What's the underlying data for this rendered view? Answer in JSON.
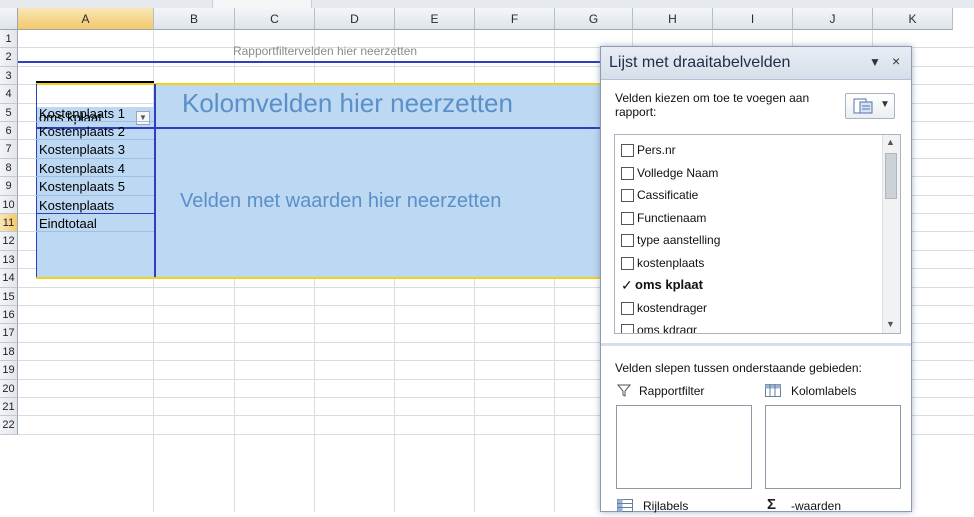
{
  "columns": [
    "A",
    "B",
    "C",
    "D",
    "E",
    "F",
    "G",
    "H",
    "I",
    "J",
    "K"
  ],
  "rows": [
    "1",
    "2",
    "3",
    "4",
    "5",
    "6",
    "7",
    "8",
    "9",
    "10",
    "11",
    "12",
    "13",
    "14",
    "15",
    "16",
    "17",
    "18",
    "19",
    "20",
    "21",
    "22"
  ],
  "pivot": {
    "report_filter_drop": "Rapportfiltervelden hier neerzetten",
    "column_drop": "Kolomvelden hier neerzetten",
    "values_drop": "Velden met waarden hier neerzetten",
    "row_header": "oms kplaat",
    "row_items": [
      "Kostenplaats 1",
      "Kostenplaats 2",
      "Kostenplaats 3",
      "Kostenplaats 4",
      "Kostenplaats 5",
      "Kostenplaats",
      "Eindtotaal"
    ]
  },
  "pane": {
    "title": "Lijst met draaitabelvelden",
    "choose_label": "Velden kiezen om toe te voegen aan rapport:",
    "fields": [
      {
        "name": "Pers.nr",
        "checked": false
      },
      {
        "name": "Volledge Naam",
        "checked": false
      },
      {
        "name": "Cassificatie",
        "checked": false
      },
      {
        "name": "Functienaam",
        "checked": false
      },
      {
        "name": "type aanstelling",
        "checked": false
      },
      {
        "name": "kostenplaats",
        "checked": false
      },
      {
        "name": "oms kplaat",
        "checked": true
      },
      {
        "name": "kostendrager",
        "checked": false
      },
      {
        "name": "oms kdragr",
        "checked": false
      }
    ],
    "drag_label": "Velden slepen tussen onderstaande gebieden:",
    "areas": {
      "report_filter": "Rapportfilter",
      "column_labels": "Kolomlabels",
      "row_labels": "Rijlabels",
      "values": "-waarden"
    },
    "checkmark": "✓",
    "close": "×",
    "dropdown": "▼"
  }
}
